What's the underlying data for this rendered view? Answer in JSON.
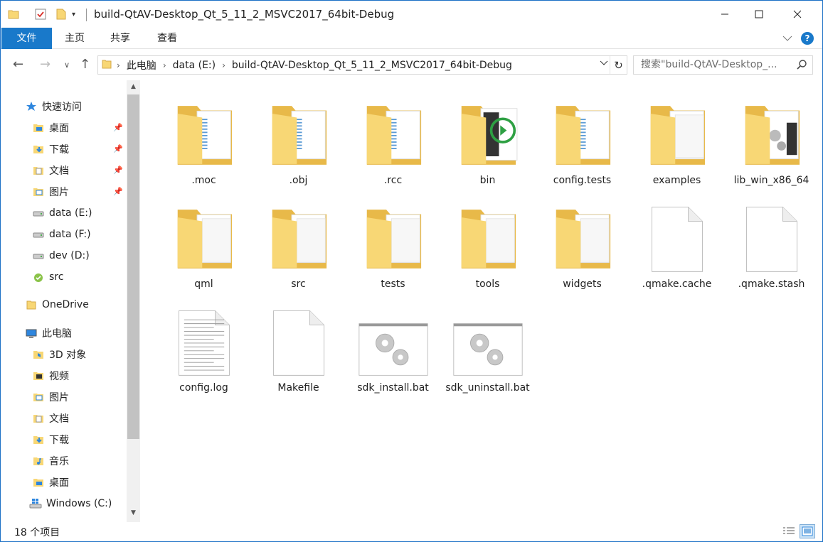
{
  "window": {
    "title": "build-QtAV-Desktop_Qt_5_11_2_MSVC2017_64bit-Debug",
    "minimize_icon": "minimize-icon",
    "maximize_icon": "maximize-icon",
    "close_icon": "close-icon"
  },
  "ribbon": {
    "tabs": [
      {
        "label": "文件"
      },
      {
        "label": "主页"
      },
      {
        "label": "共享"
      },
      {
        "label": "查看"
      }
    ],
    "help": "?",
    "accent": "#1979ca"
  },
  "address": {
    "breadcrumb": [
      "此电脑",
      "data (E:)",
      "build-QtAV-Desktop_Qt_5_11_2_MSVC2017_64bit-Debug"
    ],
    "search_placeholder": "搜索\"build-QtAV-Desktop_..."
  },
  "sidebar": {
    "items": [
      {
        "label": "快速访问",
        "icon": "star-icon",
        "pinned": false
      },
      {
        "label": "桌面",
        "icon": "desktop-folder-icon",
        "pinned": true
      },
      {
        "label": "下载",
        "icon": "download-folder-icon",
        "pinned": true
      },
      {
        "label": "文档",
        "icon": "documents-folder-icon",
        "pinned": true
      },
      {
        "label": "图片",
        "icon": "pictures-folder-icon",
        "pinned": true
      },
      {
        "label": "data (E:)",
        "icon": "drive-icon",
        "pinned": false
      },
      {
        "label": "data (F:)",
        "icon": "drive-icon",
        "pinned": false
      },
      {
        "label": "dev (D:)",
        "icon": "drive-icon",
        "pinned": false
      },
      {
        "label": "src",
        "icon": "network-folder-icon",
        "pinned": false
      },
      {
        "label": "OneDrive",
        "icon": "onedrive-folder-icon",
        "pinned": false
      },
      {
        "label": "此电脑",
        "icon": "computer-icon",
        "pinned": false
      },
      {
        "label": "3D 对象",
        "icon": "3d-objects-folder-icon",
        "pinned": false
      },
      {
        "label": "视频",
        "icon": "videos-folder-icon",
        "pinned": false
      },
      {
        "label": "图片",
        "icon": "pictures-folder-icon",
        "pinned": false
      },
      {
        "label": "文档",
        "icon": "documents-folder-icon",
        "pinned": false
      },
      {
        "label": "下载",
        "icon": "download-folder-icon",
        "pinned": false
      },
      {
        "label": "音乐",
        "icon": "music-folder-icon",
        "pinned": false
      },
      {
        "label": "桌面",
        "icon": "desktop-folder-icon",
        "pinned": false
      },
      {
        "label": "Windows (C:)",
        "icon": "windows-drive-icon",
        "pinned": false
      }
    ]
  },
  "files": [
    {
      "name": ".moc",
      "kind": "folder-docs"
    },
    {
      "name": ".obj",
      "kind": "folder-docs"
    },
    {
      "name": ".rcc",
      "kind": "folder-docs"
    },
    {
      "name": "bin",
      "kind": "folder-bin"
    },
    {
      "name": "config.tests",
      "kind": "folder-docs"
    },
    {
      "name": "examples",
      "kind": "folder-blank"
    },
    {
      "name": "lib_win_x86_64",
      "kind": "folder-lib"
    },
    {
      "name": "qml",
      "kind": "folder-blank"
    },
    {
      "name": "src",
      "kind": "folder-blank"
    },
    {
      "name": "tests",
      "kind": "folder-blank"
    },
    {
      "name": "tools",
      "kind": "folder-blank"
    },
    {
      "name": "widgets",
      "kind": "folder-blank"
    },
    {
      "name": ".qmake.cache",
      "kind": "file-blank"
    },
    {
      "name": ".qmake.stash",
      "kind": "file-blank"
    },
    {
      "name": "config.log",
      "kind": "file-text"
    },
    {
      "name": "Makefile",
      "kind": "file-blank"
    },
    {
      "name": "sdk_install.bat",
      "kind": "file-bat"
    },
    {
      "name": "sdk_uninstall.bat",
      "kind": "file-bat"
    }
  ],
  "status": {
    "count_text": "18 个项目"
  },
  "colors": {
    "folder": "#f8d775",
    "folder_dark": "#e8b949",
    "window_border": "#1c70c6"
  }
}
